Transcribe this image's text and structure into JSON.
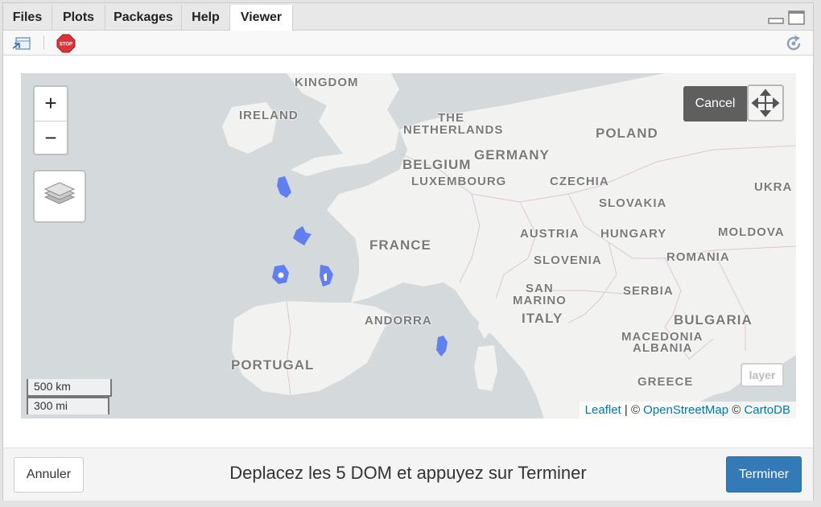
{
  "tabs": [
    {
      "label": "Files"
    },
    {
      "label": "Plots"
    },
    {
      "label": "Packages"
    },
    {
      "label": "Help"
    },
    {
      "label": "Viewer"
    }
  ],
  "active_tab": "Viewer",
  "toolbar": {
    "stop_icon_text": "STOP"
  },
  "map": {
    "labels": {
      "kingdom": "KINGDOM",
      "ireland": "IRELAND",
      "the": "THE",
      "netherlands": "NETHERLANDS",
      "poland": "POLAND",
      "germany": "GERMANY",
      "belgium": "BELGIUM",
      "luxembourg": "LUXEMBOURG",
      "czechia": "CZECHIA",
      "ukraine": "UKRA",
      "slovakia": "SLOVAKIA",
      "france": "FRANCE",
      "austria": "AUSTRIA",
      "hungary": "HUNGARY",
      "moldova": "MOLDOVA",
      "slovenia": "SLOVENIA",
      "romania": "ROMANIA",
      "san": "SAN",
      "marino": "MARINO",
      "serbia": "SERBIA",
      "italy": "ITALY",
      "andorra": "ANDORRA",
      "bulgaria": "BULGARIA",
      "macedonia": "MACEDONIA",
      "albania": "ALBANIA",
      "portugal": "PORTUGAL",
      "greece": "GREECE"
    },
    "zoom_in": "+",
    "zoom_out": "−",
    "cancel_label": "Cancel",
    "layer_label": "layer",
    "scale_km": "500 km",
    "scale_mi": "300 mi",
    "attribution": {
      "leaflet": "Leaflet",
      "sep1": " | © ",
      "osm": "OpenStreetMap",
      "sep2": " © ",
      "carto": "CartoDB"
    },
    "shape_color": "#5b7bef"
  },
  "footer": {
    "cancel_label": "Annuler",
    "instruction": "Deplacez les 5 DOM et appuyez sur Terminer",
    "done_label": "Terminer"
  }
}
